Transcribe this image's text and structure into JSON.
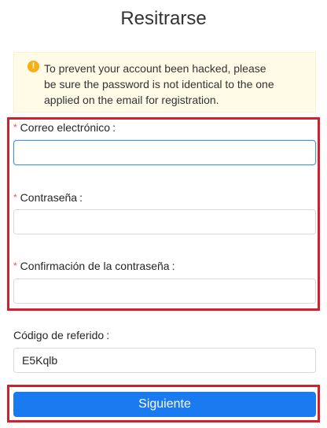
{
  "page": {
    "title": "Resitrarse"
  },
  "alert": {
    "icon": "warning-circle-icon",
    "line1": "To prevent your account been hacked, please",
    "line2": "be sure the password is not identical to the one",
    "line3": "applied on the email for registration."
  },
  "form": {
    "required_mark": "*",
    "email": {
      "label": "Correo electrónico",
      "value": ""
    },
    "password": {
      "label": "Contraseña",
      "value": ""
    },
    "confirm_password": {
      "label": "Confirmación de la contraseña",
      "value": ""
    },
    "referral": {
      "label": "Código de referido",
      "value": "E5Kqlb"
    },
    "colon": ":"
  },
  "submit": {
    "label": "Siguiente"
  },
  "colors": {
    "accent": "#1a7af0",
    "highlight_border": "#d0202d",
    "alert_bg": "#fffbe6",
    "warning": "#faad14",
    "required": "#ff4d4f"
  }
}
